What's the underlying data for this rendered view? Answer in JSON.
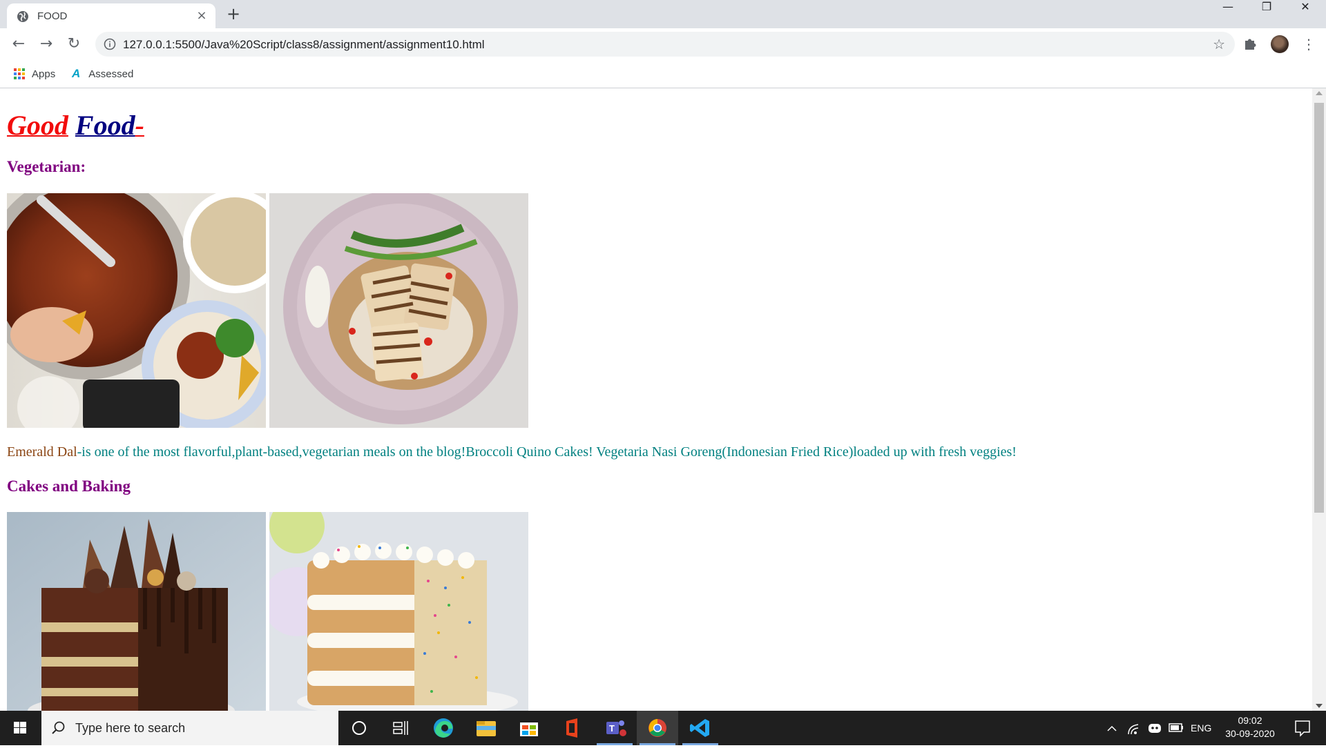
{
  "browser": {
    "tab_title": "FOOD",
    "tab_close": "×",
    "new_tab": "+",
    "url": "127.0.0.1:5500/Java%20Script/class8/assignment/assignment10.html",
    "bookmarks": [
      {
        "label": "Apps"
      },
      {
        "label": "Assessed"
      }
    ],
    "window_controls": {
      "minimize": "—",
      "restore": "❐",
      "close": "✕"
    }
  },
  "page": {
    "title_good": "Good",
    "title_food": "Food",
    "title_dash": "-",
    "section1_heading": "Vegetarian:",
    "description_emerald": "Emerald Dal",
    "description_rest": "-is one of the most flavorful,plant-based,vegetarian meals on the blog!Broccoli Quino Cakes! Vegetaria Nasi Goreng(Indonesian Fried Rice)loaded up with fresh veggies!",
    "section2_heading": "Cakes and Baking",
    "images": [
      {
        "subject": "chili-pot-with-rice"
      },
      {
        "subject": "grilled-tofu-rice-bowl"
      },
      {
        "subject": "chocolate-layer-cake"
      },
      {
        "subject": "funfetti-layer-cake"
      }
    ],
    "colors": {
      "good": "#f20c0c",
      "food": "#000080",
      "heading": "#800080",
      "text": "#008080",
      "emerald": "#8b4513"
    }
  },
  "taskbar": {
    "search_placeholder": "Type here to search",
    "language": "ENG",
    "time": "09:02",
    "date": "30-09-2020",
    "apps": [
      "cortana",
      "task-view",
      "edge",
      "file-explorer",
      "store",
      "office",
      "teams",
      "chrome",
      "vscode"
    ]
  }
}
